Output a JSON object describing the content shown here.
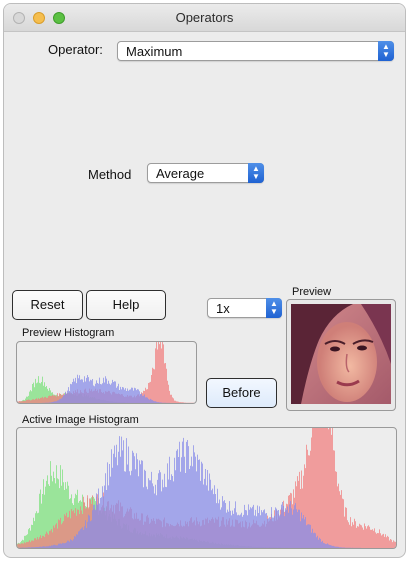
{
  "window": {
    "title": "Operators"
  },
  "operator": {
    "label": "Operator:",
    "selected": "Maximum"
  },
  "method": {
    "label": "Method",
    "selected": "Average"
  },
  "buttons": {
    "reset": "Reset",
    "help": "Help",
    "before": "Before"
  },
  "zoom": {
    "selected": "1x"
  },
  "preview": {
    "label": "Preview"
  },
  "preview_histogram": {
    "label": "Preview Histogram"
  },
  "active_histogram": {
    "label": "Active Image Histogram"
  },
  "histogram_colors": {
    "red": "#f08080",
    "green": "#7ee07e",
    "blue": "#8a8ee8"
  }
}
